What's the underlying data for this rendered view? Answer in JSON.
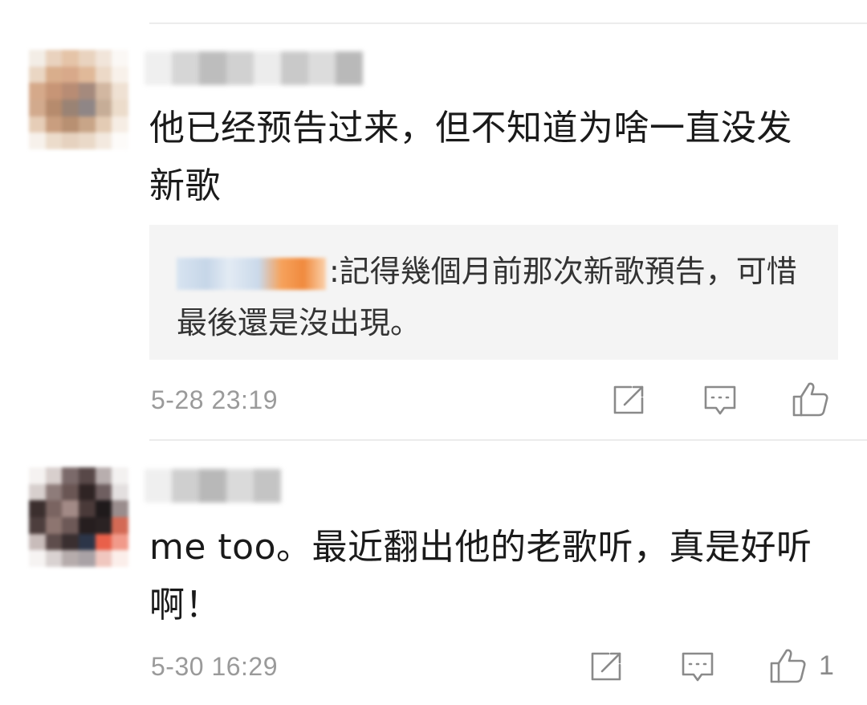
{
  "comments": [
    {
      "text": "他已经预告过来，但不知道为啥一直没发新歌",
      "quote": {
        "text": ":記得幾個月前那次新歌預告，可惜最後還是沒出現。"
      },
      "time": "5-28 23:19",
      "actions": {
        "share_icon": "share-icon",
        "comment_icon": "comment-icon",
        "like_icon": "thumbs-up-icon",
        "like_count": ""
      }
    },
    {
      "text": "me too。最近翻出他的老歌听，真是好听啊！",
      "time": "5-30 16:29",
      "actions": {
        "share_icon": "share-icon",
        "comment_icon": "comment-icon",
        "like_icon": "thumbs-up-icon",
        "like_count": "1"
      }
    }
  ],
  "colors": {
    "text": "#1a1a1a",
    "meta": "#9a9a9a",
    "icon": "#8a8a8a",
    "quote_bg": "#f4f4f4",
    "divider": "#ececec"
  }
}
